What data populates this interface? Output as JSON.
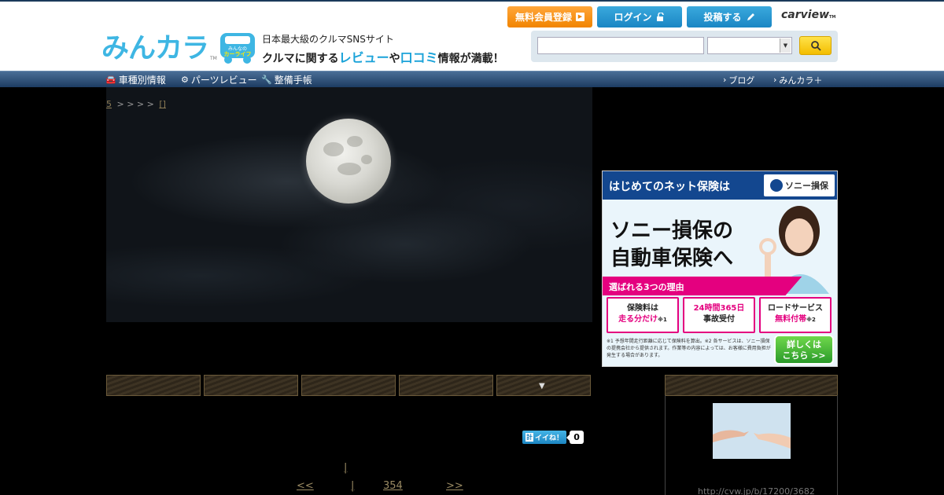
{
  "header": {
    "logo_text": "みんカラ",
    "logo_tm": "TM",
    "badge_line1": "みんなの",
    "badge_line2": "カーライフ",
    "tagline": "日本最大級のクルマSNSサイト",
    "tagline2_a": "クルマに関する",
    "tagline2_b": "レビュー",
    "tagline2_c": "や",
    "tagline2_d": "口コミ",
    "tagline2_e": "情報が満載！",
    "register_label": "無料会員登録",
    "login_label": "ログイン",
    "post_label": "投稿する",
    "carview": "carview",
    "carview_tm": "TM",
    "search_value": "",
    "select_value": ""
  },
  "nav": {
    "car_label": "車種別情報",
    "parts_label": "パーツレビュー",
    "maint_label": "整備手帳",
    "blog_label": "ブログ",
    "plus_label": "みんカラ＋"
  },
  "breadcrumb": {
    "first": "5",
    "seps": "> > > >",
    "last": "[]"
  },
  "ad": {
    "top_text": "はじめてのネット保険は",
    "brand": "ソニー損保",
    "headline1": "ソニー損保の",
    "headline2": "自動車保険へ",
    "reasons": "選ばれる3つの理由",
    "box1_a": "保険料は",
    "box1_b": "走る分だけ",
    "box1_note": "※1",
    "box2_a": "24時間365日",
    "box2_b": "事故受付",
    "box3_a": "ロードサービス",
    "box3_b": "無料付帯",
    "box3_note": "※2",
    "note": "※1 予想年間走行距離に応じて保険料を算出。※2 各サービスは、ソニー損保の提携会社から提供されます。作業等の内容によっては、お客様に費用負担が発生する場合があります。",
    "cta1": "詳しくは",
    "cta2": "こちら >>"
  },
  "like": {
    "label": "イイね！",
    "count": "0"
  },
  "pager": {
    "mid": "|",
    "prev": "<<",
    "cur": "|",
    "num": "354",
    "next": ">>"
  },
  "side": {
    "link": "http://cvw.jp/b/17200/3682"
  },
  "colors": {
    "register": "#f18400",
    "login": "#1a86c4",
    "nav_bar": "#1d3c62",
    "link_gold": "#9a8a63"
  }
}
